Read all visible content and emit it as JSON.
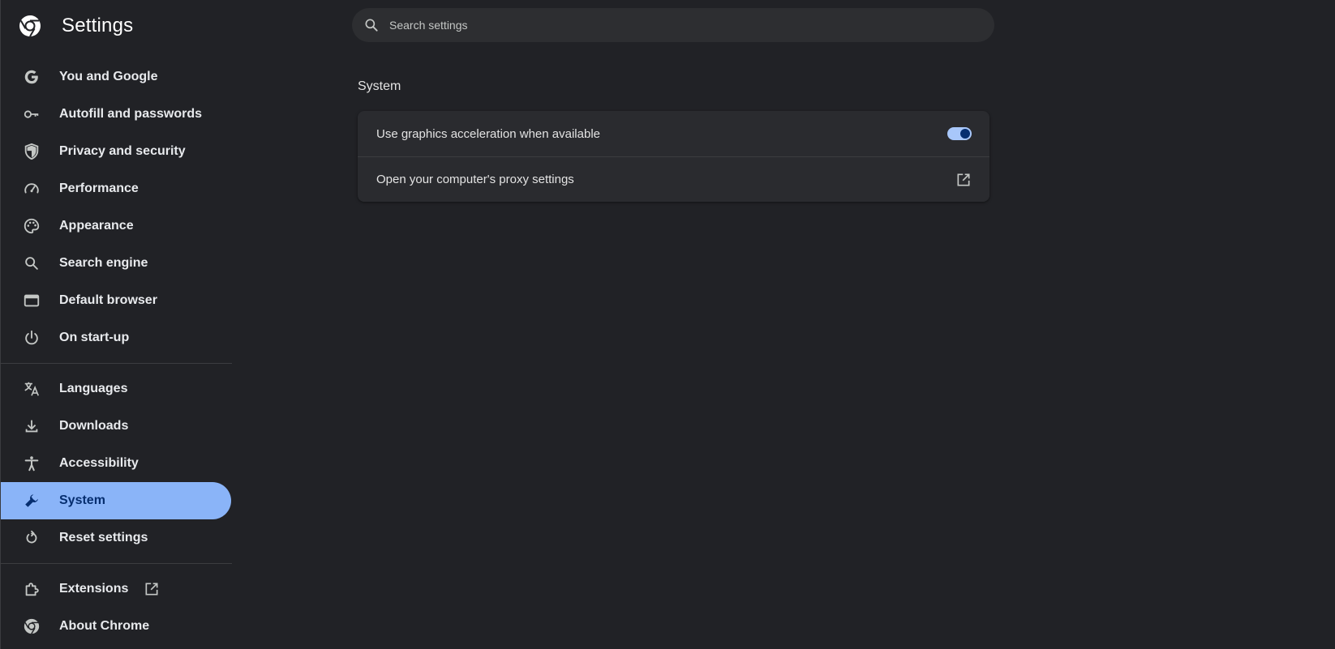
{
  "header": {
    "title": "Settings",
    "logo_icon": "chrome-logo-icon"
  },
  "search": {
    "placeholder": "Search settings",
    "value": "",
    "icon": "search-icon"
  },
  "sidebar": {
    "group1": [
      {
        "id": "you-and-google",
        "label": "You and Google",
        "icon": "google-g-icon"
      },
      {
        "id": "autofill",
        "label": "Autofill and passwords",
        "icon": "key-icon"
      },
      {
        "id": "privacy",
        "label": "Privacy and security",
        "icon": "shield-icon"
      },
      {
        "id": "performance",
        "label": "Performance",
        "icon": "speedometer-icon"
      },
      {
        "id": "appearance",
        "label": "Appearance",
        "icon": "palette-icon"
      },
      {
        "id": "search-engine",
        "label": "Search engine",
        "icon": "search-icon"
      },
      {
        "id": "default-browser",
        "label": "Default browser",
        "icon": "browser-window-icon"
      },
      {
        "id": "on-startup",
        "label": "On start-up",
        "icon": "power-icon"
      }
    ],
    "group2": [
      {
        "id": "languages",
        "label": "Languages",
        "icon": "translate-icon"
      },
      {
        "id": "downloads",
        "label": "Downloads",
        "icon": "download-icon"
      },
      {
        "id": "accessibility",
        "label": "Accessibility",
        "icon": "accessibility-icon"
      },
      {
        "id": "system",
        "label": "System",
        "icon": "wrench-icon",
        "active": true
      },
      {
        "id": "reset",
        "label": "Reset settings",
        "icon": "reset-icon"
      }
    ],
    "group3": [
      {
        "id": "extensions",
        "label": "Extensions",
        "icon": "puzzle-icon",
        "external": true
      },
      {
        "id": "about",
        "label": "About Chrome",
        "icon": "chrome-logo-icon"
      }
    ]
  },
  "main": {
    "section_title": "System",
    "rows": [
      {
        "label": "Use graphics acceleration when available",
        "control": "toggle",
        "checked": true
      },
      {
        "label": "Open your computer's proxy settings",
        "control": "open-in-new",
        "icon": "open-in-new-icon"
      }
    ]
  },
  "colors": {
    "background": "#212226",
    "accent": "#8ab4f8",
    "active_text": "#062e6f",
    "card": "#2a2b2f"
  }
}
